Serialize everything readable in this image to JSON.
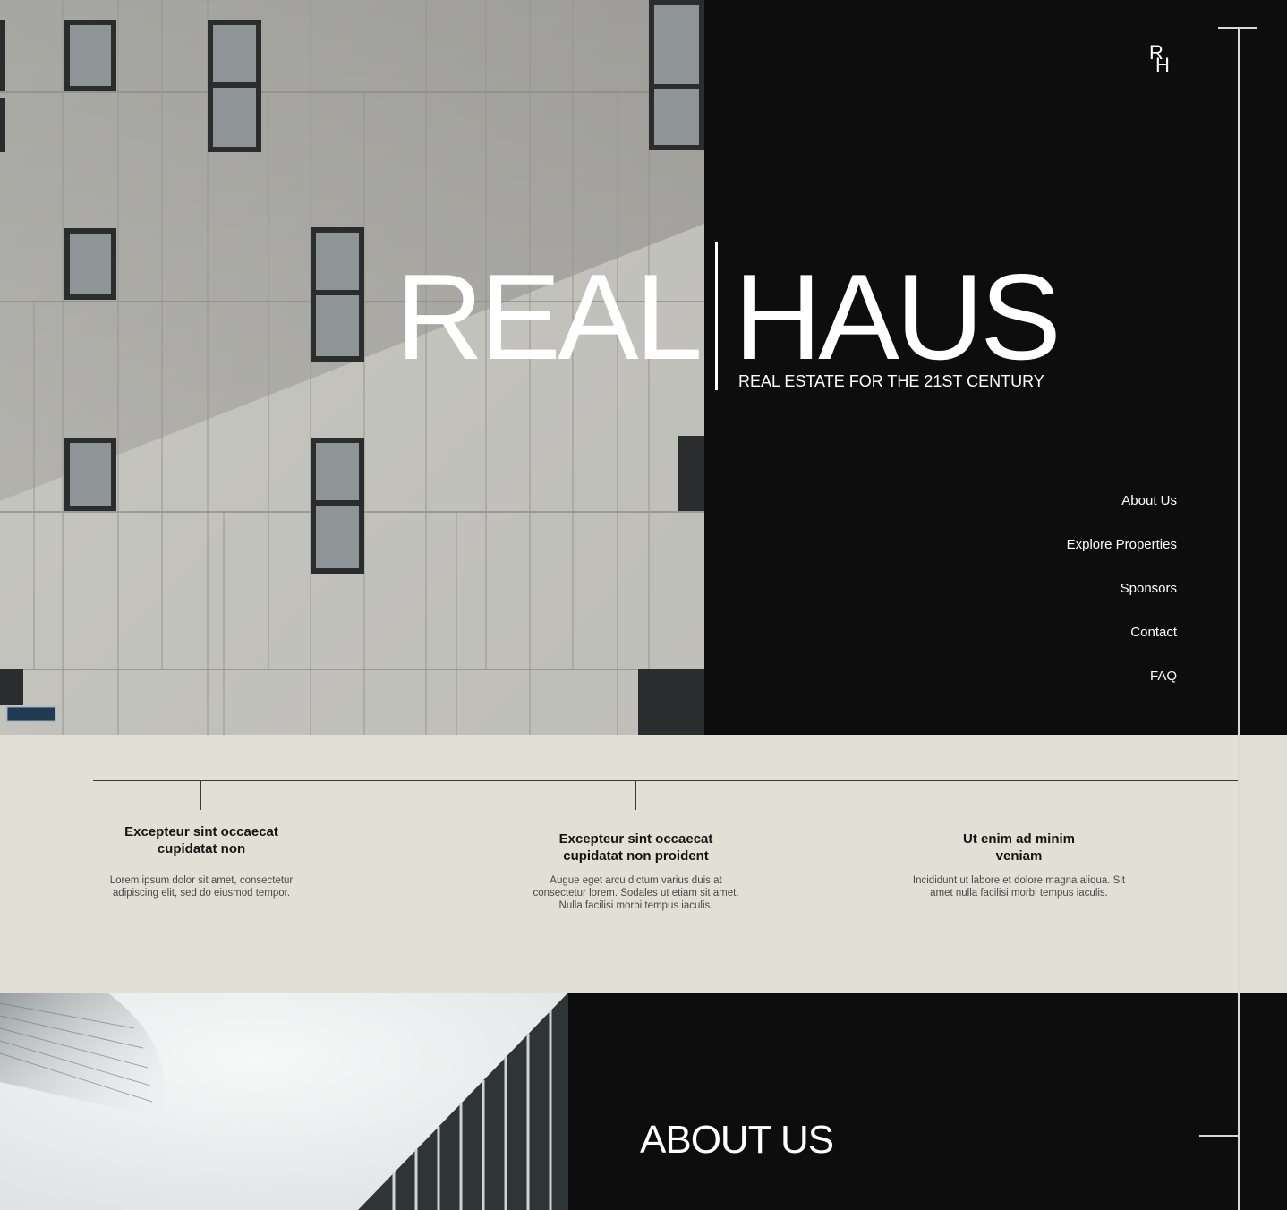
{
  "brand": {
    "word_left": "REAL",
    "word_right": "HAUS",
    "tagline": "REAL ESTATE FOR THE 21ST CENTURY",
    "logo_top": "R",
    "logo_bottom": "H"
  },
  "nav": {
    "items": [
      {
        "label": "About Us"
      },
      {
        "label": "Explore Properties"
      },
      {
        "label": "Sponsors"
      },
      {
        "label": "Contact"
      },
      {
        "label": "FAQ"
      }
    ]
  },
  "features": [
    {
      "title": "Excepteur sint occaecat cupidatat non",
      "text": "Lorem ipsum dolor sit amet, consectetur adipiscing elit, sed do eiusmod tempor."
    },
    {
      "title": "Excepteur sint occaecat cupidatat non proident",
      "text": "Augue eget arcu dictum varius duis at consectetur lorem. Sodales ut etiam sit amet. Nulla facilisi morbi tempus iaculis."
    },
    {
      "title": "Ut enim ad minim veniam",
      "text": "Incididunt ut labore et dolore magna aliqua. Sit amet nulla facilisi morbi tempus iaculis."
    }
  ],
  "about": {
    "heading": "ABOUT US"
  },
  "colors": {
    "dark_bg": "#0d0d0d",
    "beige_bg": "#e2dfd4",
    "text_light": "#ffffff"
  }
}
